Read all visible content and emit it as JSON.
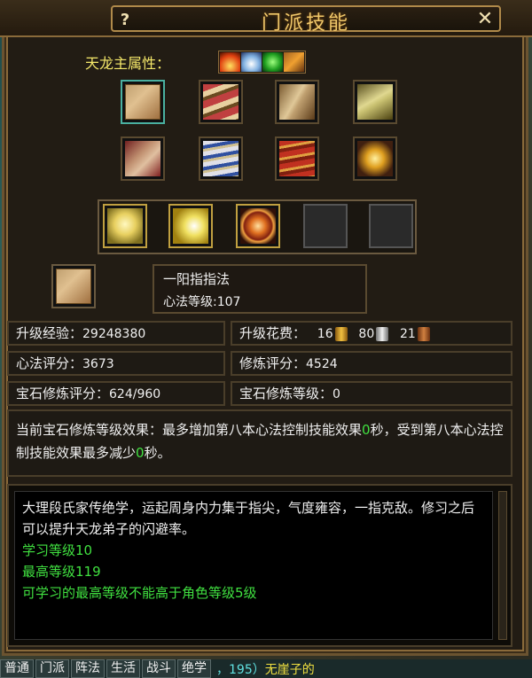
{
  "window": {
    "title": "门派技能",
    "help_label": "?",
    "close_label": "✕"
  },
  "attribute": {
    "label": "天龙主属性：",
    "icons": [
      "fire-element-icon",
      "ice-element-icon",
      "poison-element-icon",
      "thunder-element-icon"
    ]
  },
  "books": [
    {
      "name": "scroll-book-1",
      "selected": true
    },
    {
      "name": "scroll-bundle-book-2",
      "selected": false
    },
    {
      "name": "open-book-3",
      "selected": false
    },
    {
      "name": "open-book-4",
      "selected": false
    },
    {
      "name": "figure-manual-book-5",
      "selected": false
    },
    {
      "name": "blue-book-6",
      "selected": false
    },
    {
      "name": "red-book-7",
      "selected": false
    },
    {
      "name": "golden-orb-book-8",
      "selected": false
    }
  ],
  "skills": [
    {
      "name": "finger-skill-icon",
      "empty": false
    },
    {
      "name": "golden-burst-skill-icon",
      "empty": false
    },
    {
      "name": "fire-aura-skill-icon",
      "empty": false
    },
    {
      "name": "empty-skill-slot",
      "empty": true
    },
    {
      "name": "empty-skill-slot",
      "empty": true
    }
  ],
  "selected_skill": {
    "name": "一阳指指法",
    "level_text": "心法等级:107"
  },
  "stats": {
    "exp_label": "升级经验：",
    "exp_value": "29248380",
    "cost_label": "升级花费：",
    "cost_gold": "16",
    "cost_silver": "80",
    "cost_copper": "21",
    "xinfa_label": "心法评分：",
    "xinfa_value": "3673",
    "xiulian_label": "修炼评分：",
    "xiulian_value": "4524",
    "gem_score_label": "宝石修炼评分：",
    "gem_score_value": "624/960",
    "gem_level_label": "宝石修炼等级：",
    "gem_level_value": "0"
  },
  "effect": {
    "part1": "当前宝石修炼等级效果：最多增加第八本心法控制技能效果",
    "value1": "0",
    "part2": "秒，受到第八本心法控制技能效果最多减少",
    "value2": "0",
    "part3": "秒。"
  },
  "description": {
    "text": "大理段氏家传绝学，运起周身内力集于指尖，气度雍容，一指克敌。修习之后可以提升天龙弟子的闪避率。",
    "learn_level": "学习等级10",
    "max_level": "最高等级119",
    "restriction": "可学习的最高等级不能高于角色等级5级"
  },
  "chat": {
    "tabs": [
      "普通",
      "门派",
      "阵法",
      "生活",
      "战斗",
      "绝学"
    ],
    "message_prefix": "，195）",
    "message_name": "无崖子的"
  },
  "colors": {
    "title": "#f0c86a",
    "attr_label": "#f5e86a",
    "green_text": "#40e040",
    "panel_bg": "#221c14",
    "border": "#8a6a3a"
  }
}
